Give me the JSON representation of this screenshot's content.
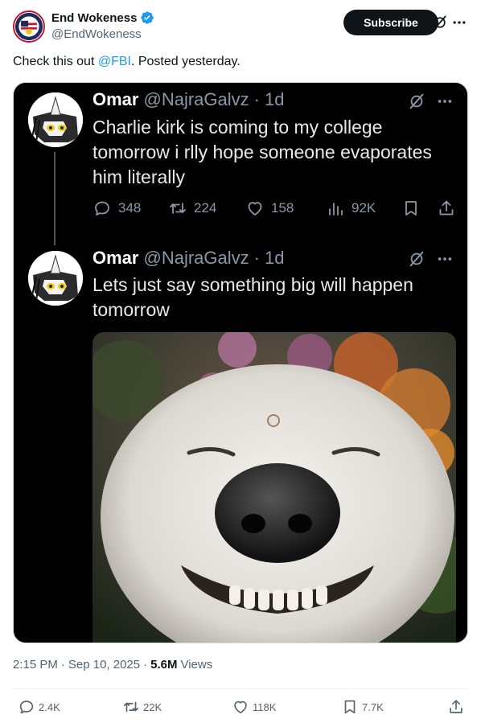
{
  "post": {
    "author_name": "End Wokeness",
    "author_handle": "@EndWokeness",
    "subscribe_label": "Subscribe",
    "text_before": "Check this out ",
    "mention": "@FBI",
    "text_after": ". Posted yesterday.",
    "time": "2:15 PM",
    "dot": "·",
    "date": "Sep 10, 2025",
    "views_count": "5.6M",
    "views_label": "Views",
    "stats": {
      "replies": "2.4K",
      "reposts": "22K",
      "likes": "118K",
      "bookmarks": "7.7K"
    }
  },
  "embed": {
    "tweets": [
      {
        "name": "Omar",
        "handle": "@NajraGalvz",
        "dot": "·",
        "age": "1d",
        "text": "Charlie kirk is coming to my college tomorrow i rlly hope someone evaporates him literally",
        "stats": {
          "replies": "348",
          "reposts": "224",
          "likes": "158",
          "views": "92K"
        }
      },
      {
        "name": "Omar",
        "handle": "@NajraGalvz",
        "dot": "·",
        "age": "1d",
        "text": "Lets just say something big will happen tomorrow"
      }
    ]
  },
  "icons": {
    "verified": "verified-badge-icon",
    "grok": "grok-icon",
    "more": "more-icon",
    "reply": "reply-icon",
    "repost": "repost-icon",
    "like": "heart-icon",
    "views": "views-icon",
    "bookmark": "bookmark-icon",
    "share": "share-icon"
  },
  "colors": {
    "accent": "#1d9bf0",
    "text_primary": "#0f1419",
    "text_secondary": "#536471",
    "embed_bg": "#000000",
    "embed_secondary": "#8b98a5"
  }
}
